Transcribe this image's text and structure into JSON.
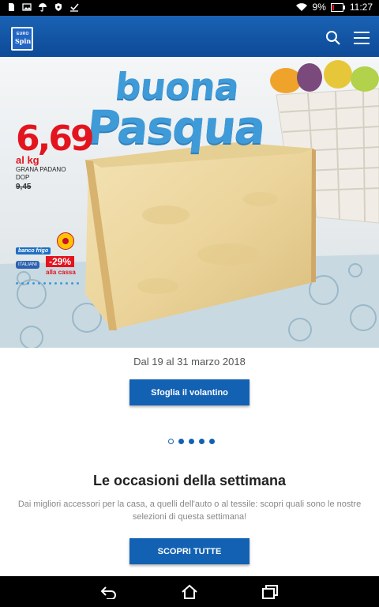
{
  "status_bar": {
    "battery_percent": "9%",
    "time": "11:27",
    "left_icons": [
      "sd-card-icon",
      "image-icon",
      "umbrella-icon",
      "shield-icon",
      "check-icon"
    ],
    "right_icons": [
      "wifi-icon",
      "battery-icon"
    ]
  },
  "app_bar": {
    "logo_text": "Spin",
    "logo_small": "EURO",
    "brand_color": "#1261b3"
  },
  "hero": {
    "title_line1": "buona",
    "title_line2": "Pasqua",
    "price": "6,69",
    "price_unit": "al kg",
    "product_line1": "GRANA PADANO",
    "product_line2": "DOP",
    "old_price": "9,45",
    "badge_banco": "banco frigo",
    "badge_italiani": "ITALIANI",
    "discount": "-29%",
    "discount_note": "alla cassa",
    "accent_blue": "#3f9ad8",
    "accent_red": "#e3141e"
  },
  "promo": {
    "date_range": "Dal 19 al 31 marzo 2018",
    "button_label": "Sfoglia il volantino"
  },
  "carousel": {
    "total_slides": 5,
    "active_index": 0
  },
  "weekly": {
    "title": "Le occasioni della settimana",
    "description": "Dai migliori accessori per la casa, a quelli dell'auto o al tessile: scopri quali sono le nostre selezioni di questa settimana!",
    "button_label": "SCOPRI TUTTE"
  },
  "nav_bar": {
    "buttons": [
      "back-icon",
      "home-icon",
      "recents-icon"
    ]
  }
}
